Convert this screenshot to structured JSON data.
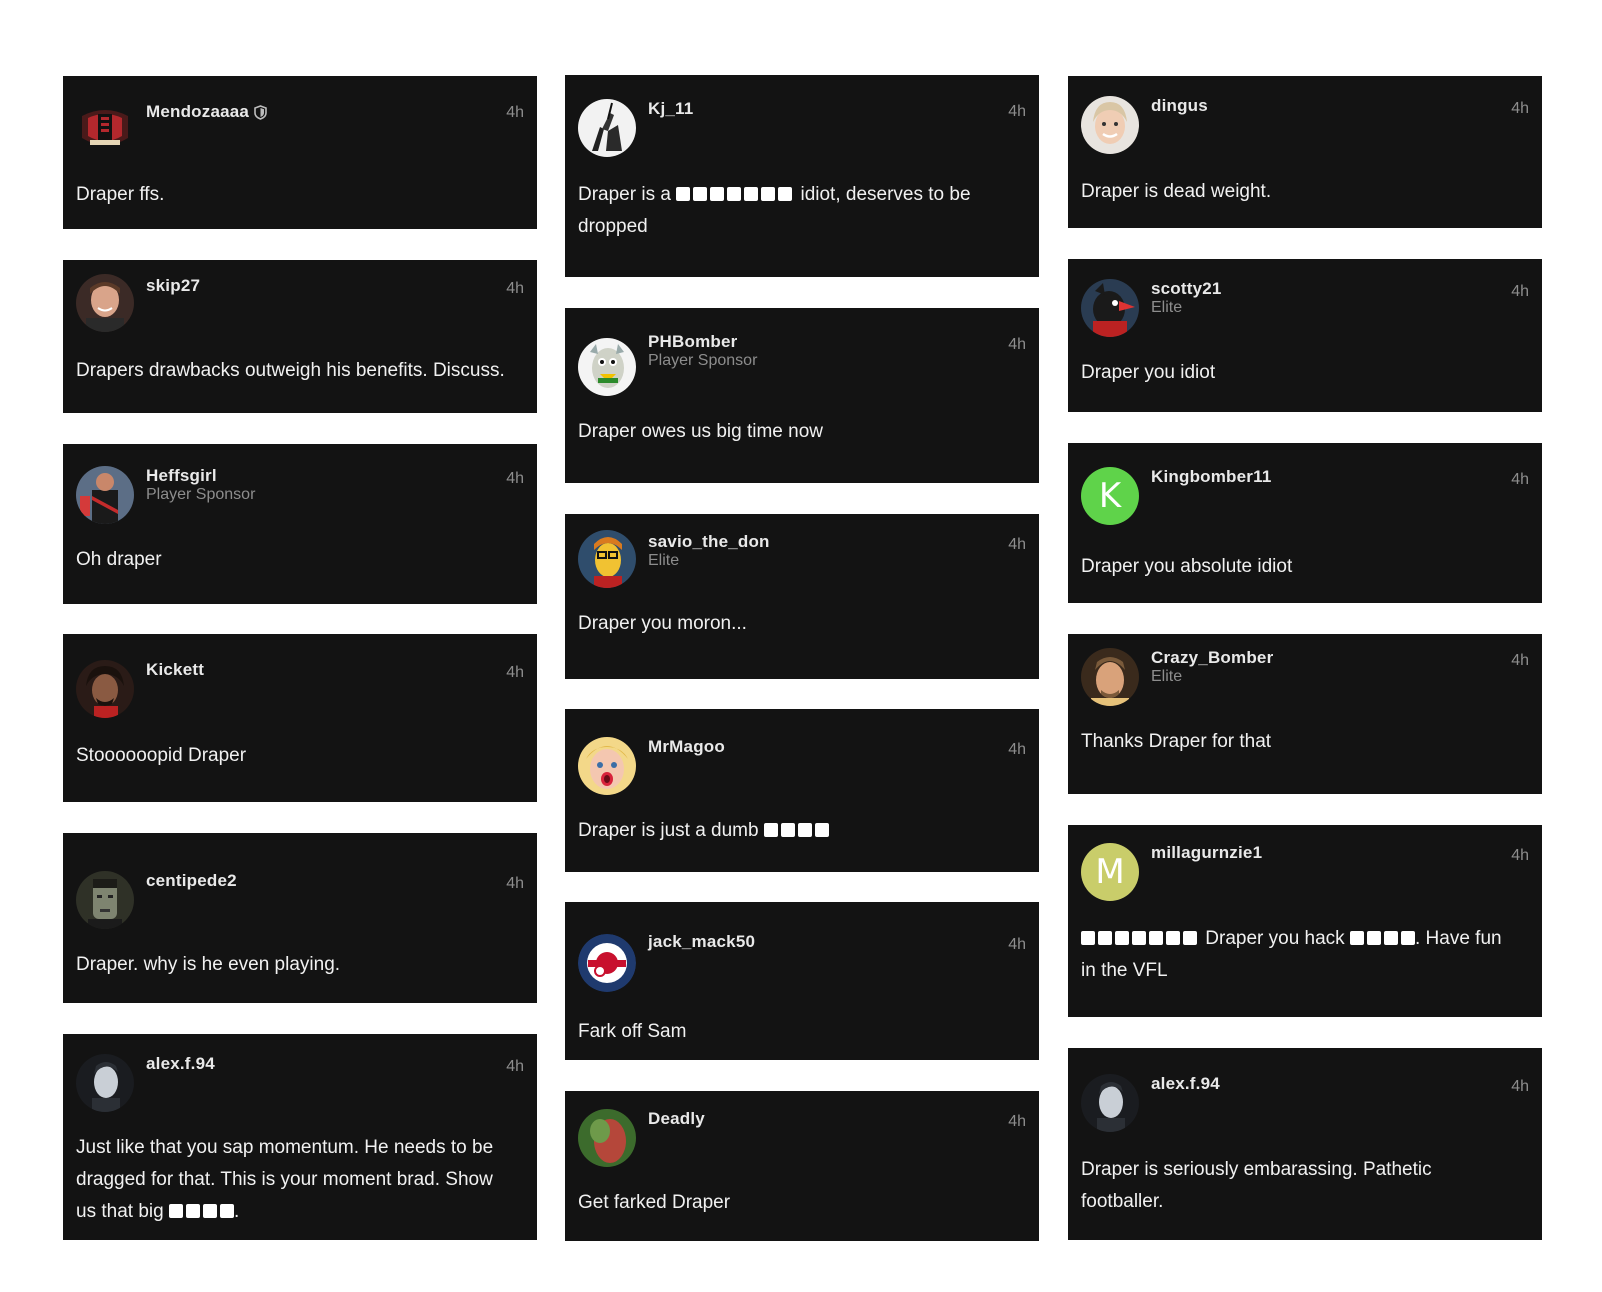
{
  "colors": {
    "page_background": "#ffffff",
    "card_background": "#131313",
    "username": "#e9e9e9",
    "meta": "#8d8d8d",
    "message": "#f1f1f1",
    "avatar_k": "#5fd34a",
    "avatar_m": "#c9cd6a"
  },
  "comments": [
    {
      "username": "Mendozaaaa",
      "badge": "",
      "time": "4h",
      "avatar_icon": "club-crest-icon",
      "message": "Draper ffs."
    },
    {
      "username": "skip27",
      "badge": "",
      "time": "4h",
      "avatar_icon": "user-photo-avatar",
      "message": "Drapers drawbacks outweigh his benefits. Discuss."
    },
    {
      "username": "Heffsgirl",
      "badge": "Player Sponsor",
      "time": "4h",
      "avatar_icon": "player-photo-avatar",
      "message": "Oh draper"
    },
    {
      "username": "Kickett",
      "badge": "",
      "time": "4h",
      "avatar_icon": "user-photo-avatar",
      "message": "Stoooooopid Draper"
    },
    {
      "username": "centipede2",
      "badge": "",
      "time": "4h",
      "avatar_icon": "monster-photo-avatar",
      "message": "Draper. why is he even playing."
    },
    {
      "username": "alex.f.94",
      "badge": "",
      "time": "4h",
      "avatar_icon": "user-photo-avatar",
      "message_line1": "Just like that you sap momentum. He needs to be",
      "message_line2": "dragged for that. This is your moment brad. Show",
      "message_line3_before": "us that big",
      "message_line3_after": "."
    },
    {
      "username": "Kj_11",
      "badge": "",
      "time": "4h",
      "avatar_icon": "statue-photo-avatar",
      "message_before": "Draper is a",
      "message_after": "idiot, deserves to be",
      "message_line2": "dropped"
    },
    {
      "username": "PHBomber",
      "badge": "Player Sponsor",
      "time": "4h",
      "avatar_icon": "cartoon-avatar",
      "message": "Draper owes us big time now"
    },
    {
      "username": "savio_the_don",
      "badge": "Elite",
      "time": "4h",
      "avatar_icon": "cartoon-avatar",
      "message": "Draper you moron..."
    },
    {
      "username": "MrMagoo",
      "badge": "",
      "time": "4h",
      "avatar_icon": "doll-avatar",
      "message_before": "Draper is just a dumb"
    },
    {
      "username": "jack_mack50",
      "badge": "",
      "time": "4h",
      "avatar_icon": "roundel-cannon-icon",
      "message": "Fark off Sam"
    },
    {
      "username": "Deadly",
      "badge": "",
      "time": "4h",
      "avatar_icon": "photo-avatar",
      "message": "Get farked Draper"
    },
    {
      "username": "dingus",
      "badge": "",
      "time": "4h",
      "avatar_icon": "user-photo-avatar",
      "message": "Draper is dead weight."
    },
    {
      "username": "scotty21",
      "badge": "Elite",
      "time": "4h",
      "avatar_icon": "bird-mascot-avatar",
      "message": "Draper you idiot"
    },
    {
      "username": "Kingbomber11",
      "badge": "",
      "time": "4h",
      "avatar_letter": "K",
      "message": "Draper you absolute idiot"
    },
    {
      "username": "Crazy_Bomber",
      "badge": "Elite",
      "time": "4h",
      "avatar_icon": "user-photo-avatar",
      "message": "Thanks Draper for that"
    },
    {
      "username": "millagurnzie1",
      "badge": "",
      "time": "4h",
      "avatar_letter": "M",
      "message_mid": "Draper you hack",
      "message_after": ". Have fun",
      "message_line2": "in the VFL"
    },
    {
      "username": "alex.f.94",
      "badge": "",
      "time": "4h",
      "avatar_icon": "user-photo-avatar",
      "message_line1": "Draper is seriously embarassing. Pathetic",
      "message_line2": "footballer."
    }
  ]
}
